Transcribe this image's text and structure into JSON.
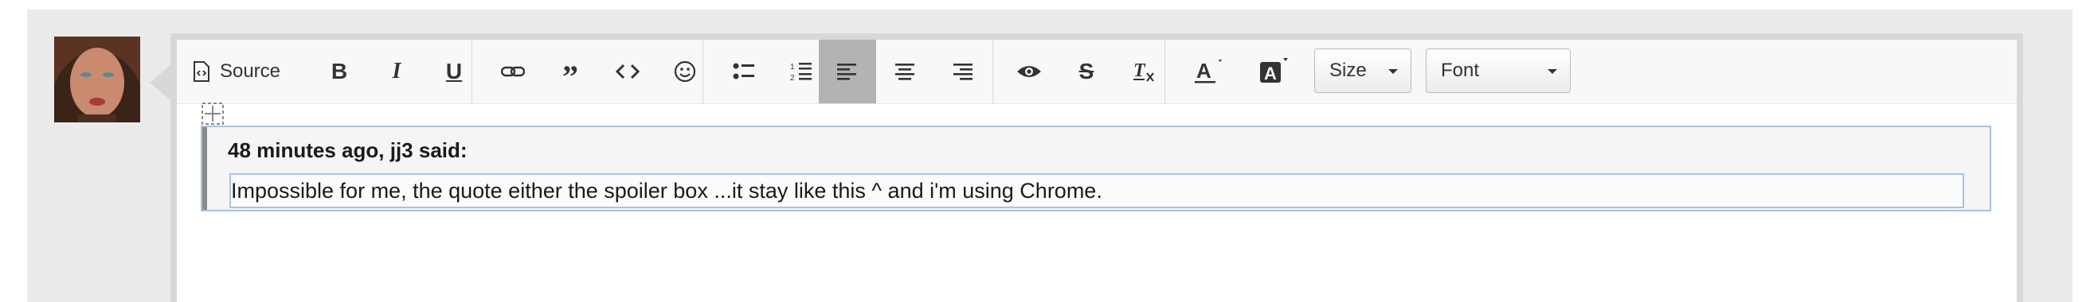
{
  "toolbar": {
    "source_label": "Source",
    "size_label": "Size",
    "font_label": "Font"
  },
  "post": {
    "quote_header": "48 minutes ago, jj3 said:",
    "quote_text": "Impossible for me, the quote either the spoiler box ...it stay like this ^ and i'm using Chrome."
  },
  "colors": {
    "active_button": "#b3b3b3",
    "quote_border": "#a8c4de",
    "toolbar_bg": "#f8f8f8"
  }
}
